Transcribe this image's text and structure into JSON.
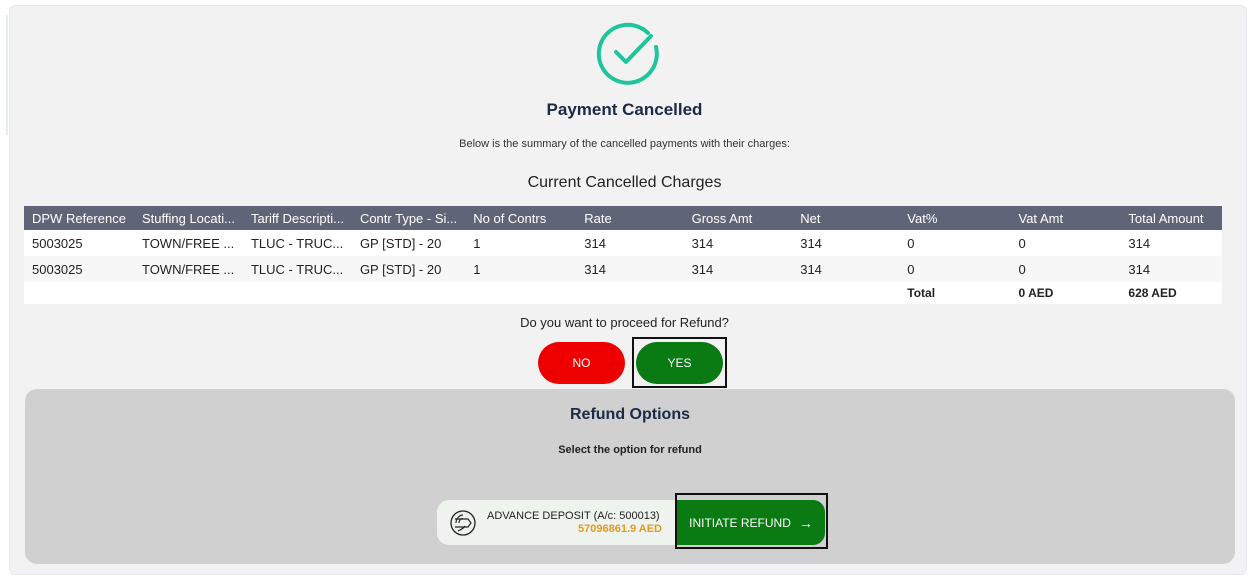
{
  "header": {
    "title": "Payment Cancelled",
    "subtitle": "Below is the summary of the cancelled payments with their charges:",
    "icon": "check-circle-icon",
    "accent_color": "#20c49a"
  },
  "charges": {
    "title": "Current Cancelled Charges",
    "columns": [
      "DPW Reference",
      "Stuffing Locati...",
      "Tariff Descripti...",
      "Contr Type - Si...",
      "No of Contrs",
      "Rate",
      "Gross Amt",
      "Net",
      "Vat%",
      "Vat Amt",
      "Total Amount"
    ],
    "rows": [
      [
        "5003025",
        "TOWN/FREE ...",
        "TLUC - TRUC...",
        "GP [STD] - 20",
        "1",
        "314",
        "314",
        "314",
        "0",
        "0",
        "314"
      ],
      [
        "5003025",
        "TOWN/FREE ...",
        "TLUC - TRUC...",
        "GP [STD] - 20",
        "1",
        "314",
        "314",
        "314",
        "0",
        "0",
        "314"
      ]
    ],
    "totals": {
      "label": "Total",
      "vat_amt": "0 AED",
      "total_amount": "628 AED"
    }
  },
  "refund_prompt": {
    "question": "Do you want to proceed for Refund?",
    "no_label": "NO",
    "yes_label": "YES",
    "no_color": "#ee0000",
    "yes_color": "#0a7a12"
  },
  "refund_options": {
    "title": "Refund Options",
    "subtitle": "Select the option for refund",
    "deposit_label": "ADVANCE DEPOSIT (A/c: 500013)",
    "deposit_amount": "57096861.9 AED",
    "deposit_icon": "fingerprint-icon",
    "initiate_label": "INITIATE REFUND",
    "initiate_icon": "arrow-right-icon",
    "amount_color": "#e39a1f"
  }
}
